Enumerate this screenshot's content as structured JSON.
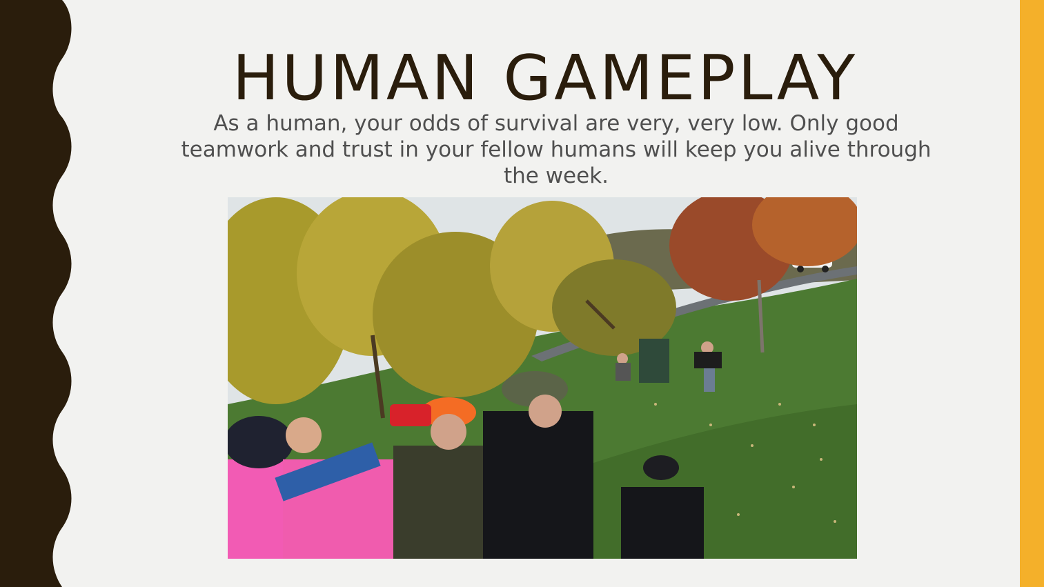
{
  "slide": {
    "title": "HUMAN GAMEPLAY",
    "body": "As a human, your odds of survival are very, very low.  Only good teamwork and trust in your fellow humans will keep you alive through the week."
  },
  "colors": {
    "background": "#f2f2f0",
    "left_band": "#2a1d0c",
    "right_band": "#f4b02a",
    "title": "#2a1d0c",
    "body": "#4f4f4f"
  },
  "photo": {
    "description_icon": "photo-outdoor-game"
  }
}
